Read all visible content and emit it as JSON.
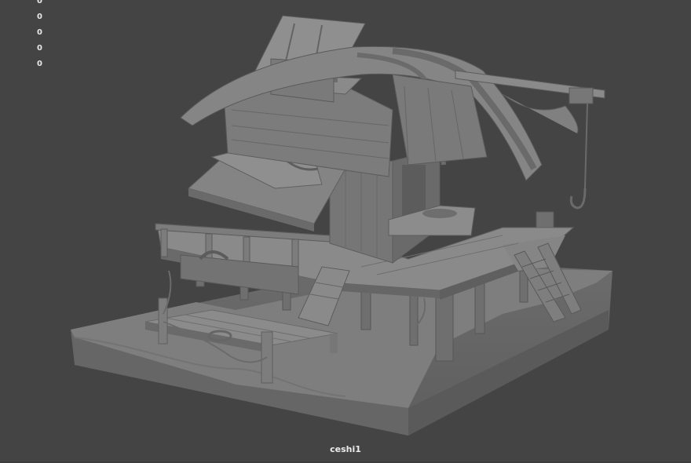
{
  "hud": {
    "values": [
      "0",
      "0",
      "0",
      "0",
      "0"
    ]
  },
  "viewport": {
    "camera_label": "ceshi1",
    "background_color": "#444444",
    "model_color": "#7a7a7a"
  }
}
